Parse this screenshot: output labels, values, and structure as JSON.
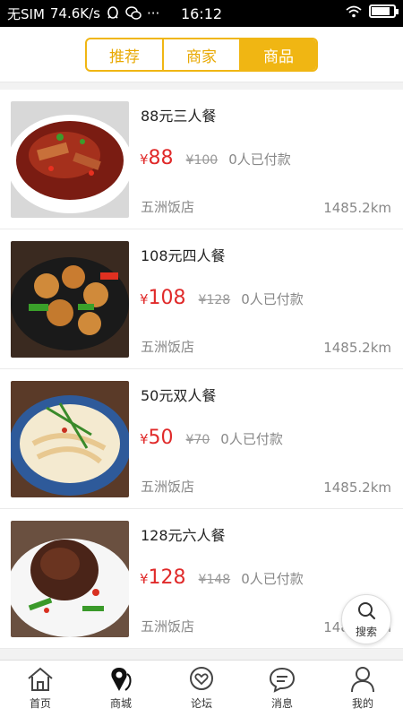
{
  "status_bar": {
    "carrier": "无SIM",
    "speed": "74.6K/s",
    "extra": "···",
    "time": "16:12",
    "battery_level": 0.85
  },
  "segments": {
    "items": [
      "推荐",
      "商家",
      "商品"
    ],
    "active_index": 2
  },
  "products": [
    {
      "name": "88元三人餐",
      "price": "88",
      "original": "¥100",
      "paid": "0人已付款",
      "shop": "五洲饭店",
      "distance": "1485.2km"
    },
    {
      "name": "108元四人餐",
      "price": "108",
      "original": "¥128",
      "paid": "0人已付款",
      "shop": "五洲饭店",
      "distance": "1485.2km"
    },
    {
      "name": "50元双人餐",
      "price": "50",
      "original": "¥70",
      "paid": "0人已付款",
      "shop": "五洲饭店",
      "distance": "1485.2km"
    },
    {
      "name": "128元六人餐",
      "price": "128",
      "original": "¥148",
      "paid": "0人已付款",
      "shop": "五洲饭店",
      "distance": "1485.2km"
    }
  ],
  "currency_symbol": "¥",
  "search_fab": {
    "label": "搜索"
  },
  "tabbar": {
    "items": [
      {
        "label": "首页",
        "icon": "home-icon"
      },
      {
        "label": "商城",
        "icon": "map-pin-icon"
      },
      {
        "label": "论坛",
        "icon": "heart-chat-icon"
      },
      {
        "label": "消息",
        "icon": "message-icon"
      },
      {
        "label": "我的",
        "icon": "user-icon"
      }
    ],
    "active_index": 1
  },
  "colors": {
    "accent": "#f0b613",
    "price": "#e02a2a"
  }
}
